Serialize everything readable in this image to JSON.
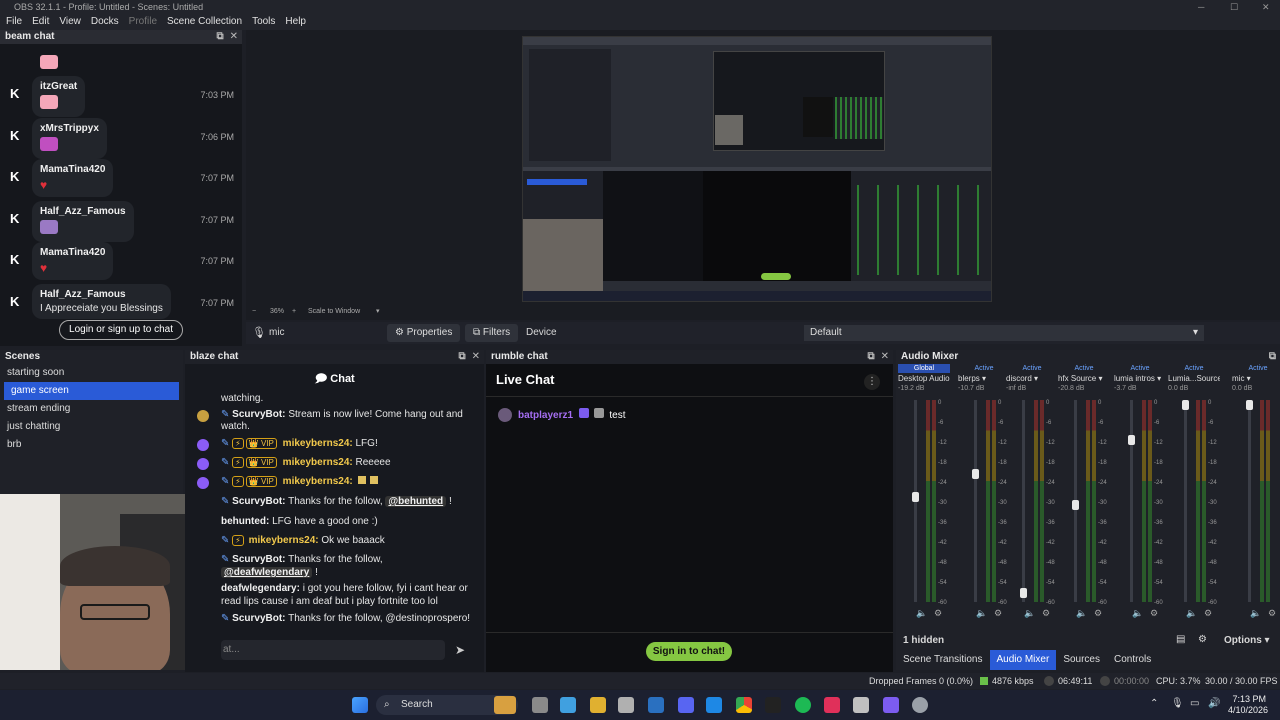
{
  "window": {
    "title": "OBS 32.1.1 - Profile: Untitled - Scenes: Untitled"
  },
  "menu": [
    "File",
    "Edit",
    "View",
    "Docks",
    "Profile",
    "Scene Collection",
    "Tools",
    "Help"
  ],
  "beam_chat": {
    "title": "beam chat",
    "messages": [
      {
        "user": "itzGreat",
        "msg": "",
        "time": "7:03 PM"
      },
      {
        "user": "xMrsTrippyx",
        "msg": "",
        "time": "7:06 PM"
      },
      {
        "user": "MamaTina420",
        "msg": "",
        "time": "7:07 PM"
      },
      {
        "user": "Half_Azz_Famous",
        "msg": "",
        "time": "7:07 PM"
      },
      {
        "user": "MamaTina420",
        "msg": "",
        "time": "7:07 PM"
      },
      {
        "user": "Half_Azz_Famous",
        "msg": "I Appreceiate you Blessings",
        "time": "7:07 PM"
      }
    ],
    "login_label": "Login or sign up to chat"
  },
  "preview": {
    "zoom": "36%",
    "scale": "Scale to Window"
  },
  "controls": {
    "source": "mic",
    "properties": "Properties",
    "filters": "Filters",
    "device_label": "Device",
    "device_value": "Default"
  },
  "scenes": {
    "title": "Scenes",
    "items": [
      "starting soon",
      "game screen",
      "stream ending",
      "just chatting",
      "brb"
    ],
    "selected": 1
  },
  "blaze_chat": {
    "title": "blaze chat",
    "header": "Chat",
    "lines": [
      {
        "text": "watching."
      },
      {
        "user": "ScurvyBot:",
        "text": "Stream is now live! Come hang out and"
      },
      {
        "text": "watch."
      },
      {
        "user": "mikeyberns24:",
        "text": "LFG!",
        "vip": "VIP"
      },
      {
        "user": "mikeyberns24:",
        "text": "Reeeee",
        "vip": "VIP"
      },
      {
        "user": "mikeyberns24:",
        "text": "",
        "vip": "VIP"
      },
      {
        "user": "ScurvyBot:",
        "text": "Thanks for the follow,",
        "mention": "@behunted",
        "tail": "!"
      },
      {
        "user": "behunted:",
        "text": "LFG have a good one :)"
      },
      {
        "user": "mikeyberns24:",
        "text": "Ok we baaack"
      },
      {
        "user": "ScurvyBot:",
        "text": "Thanks for the follow,"
      },
      {
        "mention": "@deafwlegendary",
        "tail": "!"
      },
      {
        "user": "deafwlegendary:",
        "text": "i got you here follow, fyi i cant hear or"
      },
      {
        "text": "read lips cause i am deaf but i play fortnite too lol"
      },
      {
        "user": "ScurvyBot:",
        "text": "Thanks for the follow, @destinoprospero!"
      }
    ],
    "input_placeholder": "at..."
  },
  "rumble_chat": {
    "title": "rumble chat",
    "header": "Live Chat",
    "message_user": "batplayerz1",
    "message_text": "test",
    "sign_in": "Sign in to chat!"
  },
  "mixer": {
    "title": "Audio Mixer",
    "channels": [
      {
        "status": "Global",
        "name": "Desktop Audio",
        "db": "-19.2 dB",
        "fader": 0.52
      },
      {
        "status": "Active",
        "name": "blerps",
        "db": "-10.7 dB",
        "fader": 0.64
      },
      {
        "status": "Active",
        "name": "discord",
        "db": "-inf dB",
        "fader": 0.02
      },
      {
        "status": "Active",
        "name": "hfx Source",
        "db": "-20.8 dB",
        "fader": 0.48
      },
      {
        "status": "Active",
        "name": "lumia intros",
        "db": "-3.7 dB",
        "fader": 0.82
      },
      {
        "status": "Active",
        "name": "Lumia...Source",
        "db": "0.0 dB",
        "fader": 1.0
      },
      {
        "status": "Active",
        "name": "mic",
        "db": "0.0 dB",
        "fader": 1.0
      }
    ],
    "ticks": [
      "0",
      "-6",
      "-12",
      "-18",
      "-24",
      "-30",
      "-36",
      "-42",
      "-48",
      "-54",
      "-60"
    ],
    "hidden": "1 hidden",
    "options": "Options"
  },
  "bottom_tabs": [
    "Scene Transitions",
    "Audio Mixer",
    "Sources",
    "Controls"
  ],
  "bottom_tab_selected": 1,
  "status": {
    "dropped": "Dropped Frames 0 (0.0%)",
    "kbps": "4876 kbps",
    "stream_time": "06:49:11",
    "rec_time": "00:00:00",
    "cpu": "CPU: 3.7%",
    "fps": "30.00 / 30.00 FPS"
  },
  "taskbar": {
    "search": "Search",
    "time": "7:13 PM",
    "date": "4/10/2026"
  },
  "colors": {
    "accent": "#2a5bd7",
    "gold": "#f2c94c",
    "rumble_green": "#85c742"
  }
}
